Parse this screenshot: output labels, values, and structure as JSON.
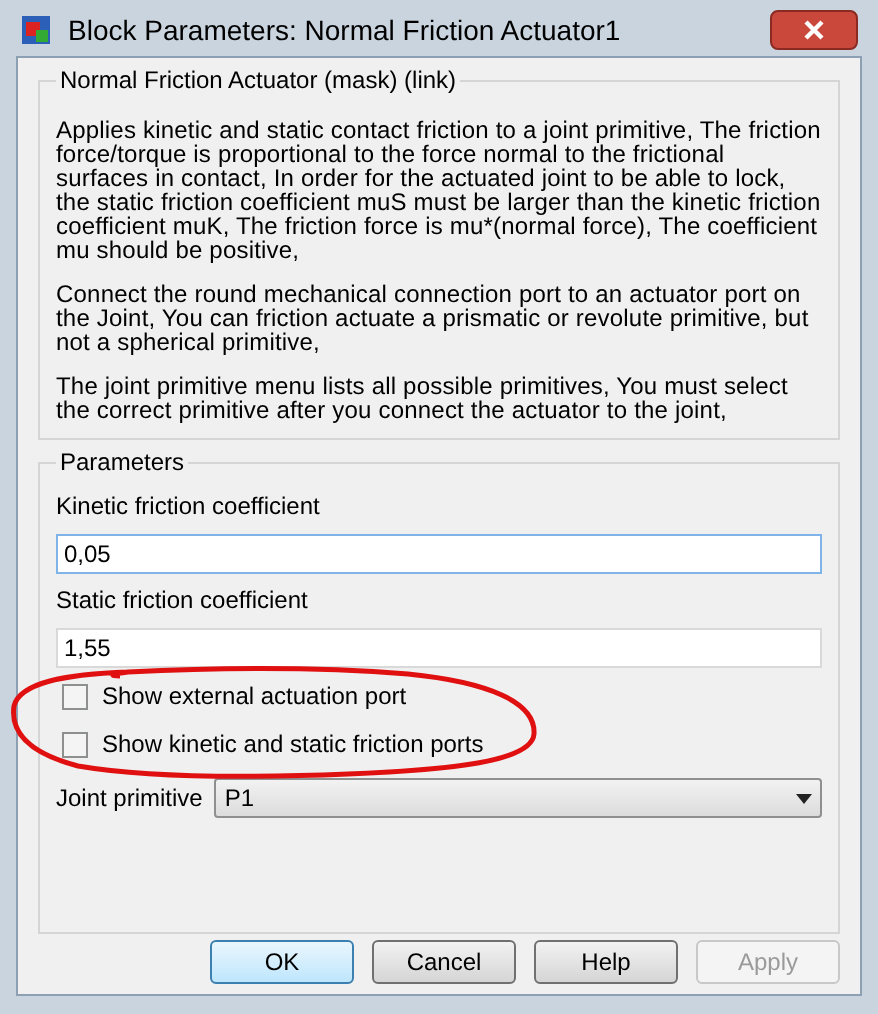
{
  "window": {
    "title": "Block Parameters: Normal Friction Actuator1"
  },
  "description": {
    "title": "Normal Friction Actuator (mask) (link)",
    "paragraphs": [
      "Applies kinetic and static contact friction to a joint primitive, The friction force/torque is proportional to the force normal to the frictional surfaces in contact, In order for the actuated joint to be able to lock, the static friction coefficient muS must be larger than the kinetic friction coefficient muK, The friction force is mu*(normal force), The coefficient mu should be positive,",
      "Connect the round mechanical connection port to an actuator port on the Joint, You can friction actuate a prismatic or revolute primitive, but not a spherical primitive,",
      "The joint primitive menu lists all possible primitives, You must select the correct primitive after you connect the actuator to the joint,"
    ]
  },
  "parameters": {
    "title": "Parameters",
    "fields": [
      {
        "label": "Kinetic friction coefficient",
        "value": "0,05",
        "focused": true
      },
      {
        "label": "Static friction coefficient",
        "value": "1,55",
        "focused": false
      }
    ],
    "checkboxes": [
      {
        "label": "Show external actuation port",
        "checked": false
      },
      {
        "label": "Show kinetic and static friction ports",
        "checked": false
      }
    ],
    "dropdown": {
      "label": "Joint primitive",
      "value": "P1"
    }
  },
  "buttons": [
    {
      "label": "OK",
      "default": true,
      "disabled": false
    },
    {
      "label": "Cancel",
      "default": false,
      "disabled": false
    },
    {
      "label": "Help",
      "default": false,
      "disabled": false
    },
    {
      "label": "Apply",
      "default": false,
      "disabled": true
    }
  ]
}
